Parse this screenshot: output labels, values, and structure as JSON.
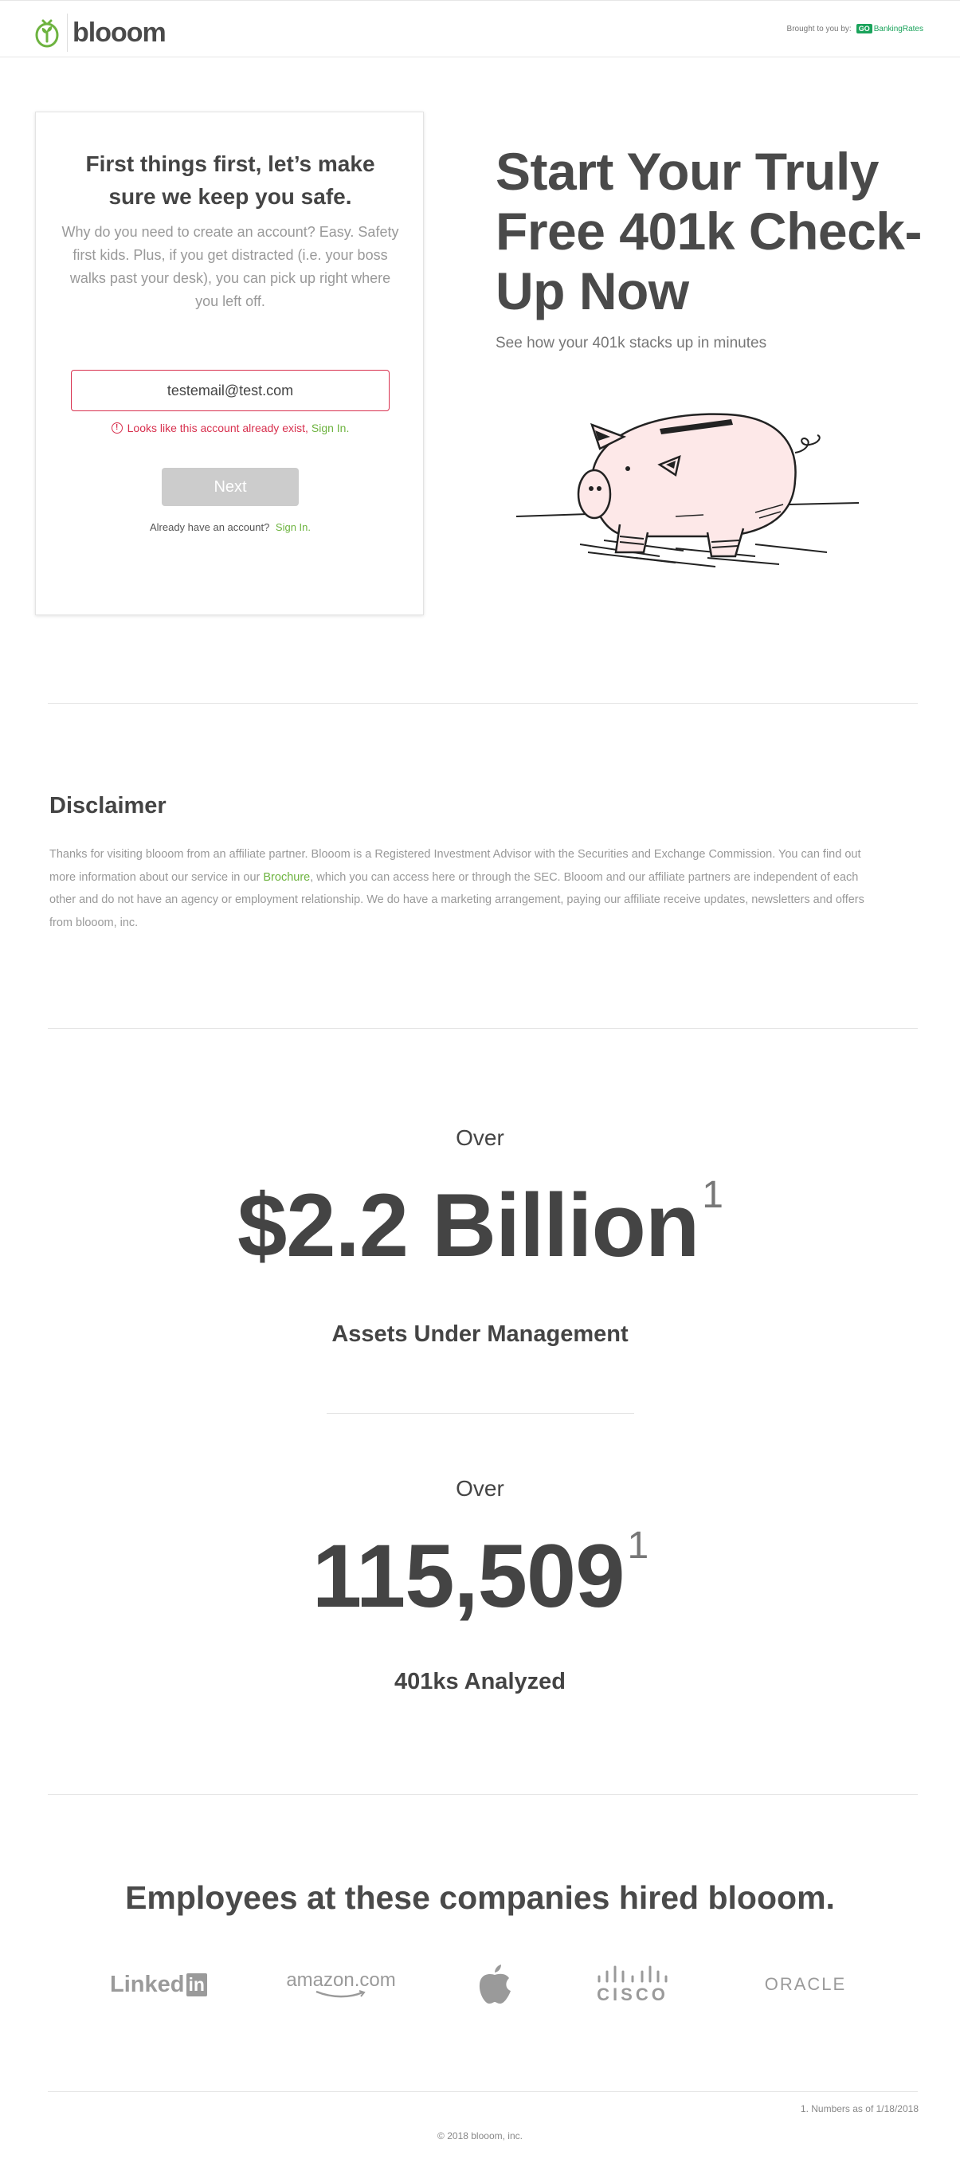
{
  "header": {
    "brand": "blooom",
    "brought_by": "Brought to you by:",
    "partner_badge": "GO",
    "partner_name": "BankingRates"
  },
  "signup": {
    "heading": "First things first, let’s make sure we keep you safe.",
    "description": "Why do you need to create an account? Easy. Safety first kids. Plus, if you get distracted (i.e. your boss walks past your desk), you can pick up right where you left off.",
    "email_value": "testemail@test.com",
    "error_text": "Looks like this account already exist,",
    "error_link": "Sign In.",
    "next_label": "Next",
    "already_text": "Already have an account?",
    "already_link": "Sign In."
  },
  "hero": {
    "title": "Start Your Truly Free 401k Check-Up Now",
    "subtitle": "See how your 401k stacks up in minutes"
  },
  "disclaimer": {
    "title": "Disclaimer",
    "text_1": "Thanks for visiting blooom from an affiliate partner. Blooom is a Registered Investment Advisor with the Securities and Exchange Commission. You can find out more information about our service in our",
    "brochure_link": "Brochure",
    "text_2": ", which you can access here or through the SEC. Blooom and our affiliate partners are independent of each other and do not have an agency or employment relationship. We do have a marketing arrangement, paying our affiliate receive updates, newsletters and offers from blooom, inc."
  },
  "stats": [
    {
      "prefix": "Over",
      "value": "$2.2 Billion",
      "footnote": "1",
      "label": "Assets Under Management"
    },
    {
      "prefix": "Over",
      "value": "115,509",
      "footnote": "1",
      "label": "401ks Analyzed"
    }
  ],
  "companies": {
    "title": "Employees at these companies hired blooom.",
    "logos": [
      "linkedin-logo",
      "amazon-logo",
      "apple-logo",
      "cisco-logo",
      "oracle-logo"
    ],
    "linkedin_text": "Linked",
    "linkedin_in": "in",
    "amazon_text": "amazon.com",
    "cisco_text": "CISCO",
    "oracle_text": "ORACLE"
  },
  "footer": {
    "footnote": "1. Numbers as of 1/18/2018",
    "copyright": "© 2018 blooom, inc."
  },
  "colors": {
    "accent_green": "#6db33f",
    "error_red": "#d8304e",
    "partner_green": "#1aa35b",
    "text_dark": "#444444",
    "button_disabled": "#cccccc",
    "pig_pink": "#fde8e8"
  }
}
